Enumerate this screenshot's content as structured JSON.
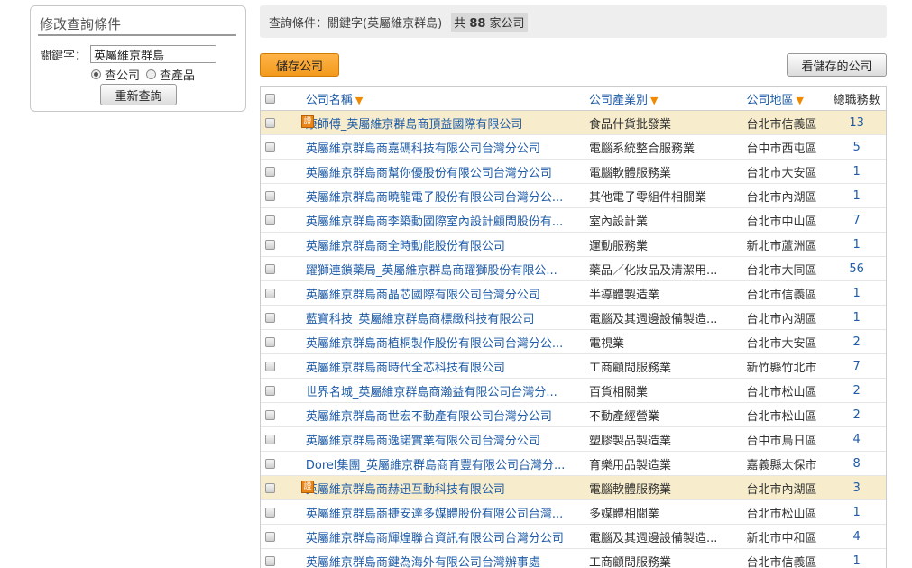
{
  "left_panel": {
    "title": "修改查詢條件",
    "keyword_label": "關鍵字：",
    "keyword_value": "英屬維京群島",
    "radio_company": "查公司",
    "radio_product": "查產品",
    "requery_button": "重新查詢"
  },
  "query_bar": {
    "condition_text": "查詢條件：關鍵字(英屬維京群島)",
    "count_prefix": "共",
    "count_value": "88",
    "count_suffix": "家公司"
  },
  "buttons": {
    "save_company": "儲存公司",
    "view_saved": "看儲存的公司"
  },
  "table": {
    "headers": {
      "name": "公司名稱",
      "industry": "公司產業別",
      "area": "公司地區",
      "count": "總職務數"
    },
    "badge_label": "證",
    "rows": [
      {
        "name": "康師傅_英屬維京群島商頂益國際有限公司",
        "industry": "食品什貨批發業",
        "area": "台北市信義區",
        "count": "13",
        "highlight": true
      },
      {
        "name": "英屬維京群島商嘉碼科技有限公司台灣分公司",
        "industry": "電腦系統整合服務業",
        "area": "台中市西屯區",
        "count": "5",
        "highlight": false
      },
      {
        "name": "英屬維京群島商幫你優股份有限公司台灣分公司",
        "industry": "電腦軟體服務業",
        "area": "台北市大安區",
        "count": "1",
        "highlight": false
      },
      {
        "name": "英屬維京群島商曉龍電子股份有限公司台灣分公...",
        "industry": "其他電子零組件相關業",
        "area": "台北市內湖區",
        "count": "1",
        "highlight": false
      },
      {
        "name": "英屬維京群島商李築動國際室內設計顧問股份有...",
        "industry": "室內設計業",
        "area": "台北市中山區",
        "count": "7",
        "highlight": false
      },
      {
        "name": "英屬維京群島商全時動能股份有限公司",
        "industry": "運動服務業",
        "area": "新北市蘆洲區",
        "count": "1",
        "highlight": false
      },
      {
        "name": "躍獅連鎖藥局_英屬維京群島商躍獅股份有限公...",
        "industry": "藥品／化妝品及清潔用...",
        "area": "台北市大同區",
        "count": "56",
        "highlight": false
      },
      {
        "name": "英屬維京群島商晶芯國際有限公司台灣分公司",
        "industry": "半導體製造業",
        "area": "台北市信義區",
        "count": "1",
        "highlight": false
      },
      {
        "name": "藍寶科技_英屬維京群島商標緻科技有限公司",
        "industry": "電腦及其週邊設備製造...",
        "area": "台北市內湖區",
        "count": "1",
        "highlight": false
      },
      {
        "name": "英屬維京群島商植桐製作股份有限公司台灣分公...",
        "industry": "電視業",
        "area": "台北市大安區",
        "count": "2",
        "highlight": false
      },
      {
        "name": "英屬維京群島商時代全芯科技有限公司",
        "industry": "工商顧問服務業",
        "area": "新竹縣竹北市",
        "count": "7",
        "highlight": false
      },
      {
        "name": "世界名城_英屬維京群島商瀚益有限公司台灣分...",
        "industry": "百貨相關業",
        "area": "台北市松山區",
        "count": "2",
        "highlight": false
      },
      {
        "name": "英屬維京群島商世宏不動產有限公司台灣分公司",
        "industry": "不動產經營業",
        "area": "台北市松山區",
        "count": "2",
        "highlight": false
      },
      {
        "name": "英屬維京群島商逸諾實業有限公司台灣分公司",
        "industry": "塑膠製品製造業",
        "area": "台中市烏日區",
        "count": "4",
        "highlight": false
      },
      {
        "name": "Dorel集團_英屬維京群島商育豐有限公司台灣分...",
        "industry": "育樂用品製造業",
        "area": "嘉義縣太保市",
        "count": "8",
        "highlight": false
      },
      {
        "name": "英屬維京群島商赫迅互動科技有限公司",
        "industry": "電腦軟體服務業",
        "area": "台北市內湖區",
        "count": "3",
        "highlight": true
      },
      {
        "name": "英屬維京群島商捷安達多媒體股份有限公司台灣...",
        "industry": "多媒體相關業",
        "area": "台北市松山區",
        "count": "1",
        "highlight": false
      },
      {
        "name": "英屬維京群島商輝煌聯合資訊有限公司台灣分公司",
        "industry": "電腦及其週邊設備製造...",
        "area": "新北市中和區",
        "count": "4",
        "highlight": false
      },
      {
        "name": "英屬維京群島商鍵為海外有限公司台灣辦事處",
        "industry": "工商顧問服務業",
        "area": "台北市信義區",
        "count": "1",
        "highlight": false
      }
    ]
  }
}
